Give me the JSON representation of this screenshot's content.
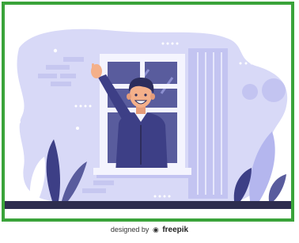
{
  "credit": {
    "prefix": "designed by",
    "brand": "freepik",
    "brand_icon": "freepik-bull-icon"
  },
  "colors": {
    "frame_border": "#3aa33a",
    "blob": "#d8d9f7",
    "panel": "#c3c4f1",
    "window_frame": "#f4f4fe",
    "glass": "#595c9d",
    "shirt": "#3d3f86",
    "skin": "#f4b08a",
    "hair": "#2c2d5c",
    "floor": "#2e2d4f",
    "plant_dark": "#3d3f86",
    "plant_light": "#b4b6ee"
  }
}
